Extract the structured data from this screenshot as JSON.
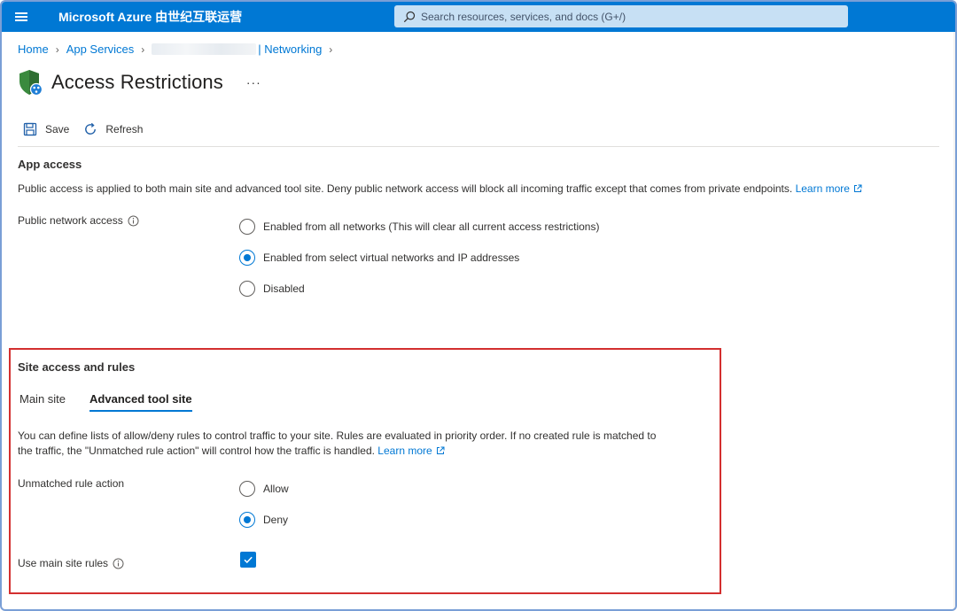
{
  "header": {
    "brand": "Microsoft Azure 由世纪互联运营",
    "search_placeholder": "Search resources, services, and docs (G+/)"
  },
  "breadcrumb": {
    "home": "Home",
    "app_services": "App Services",
    "networking": "| Networking"
  },
  "page": {
    "title": "Access Restrictions",
    "more": "···"
  },
  "toolbar": {
    "save": "Save",
    "refresh": "Refresh"
  },
  "app_access": {
    "heading": "App access",
    "description": "Public access is applied to both main site and advanced tool site. Deny public network access will block all incoming traffic except that comes from private endpoints.",
    "learn_more": "Learn more",
    "public_network_label": "Public network access",
    "options": [
      {
        "label": "Enabled from all networks (This will clear all current access restrictions)",
        "checked": false
      },
      {
        "label": "Enabled from select virtual networks and IP addresses",
        "checked": true
      },
      {
        "label": "Disabled",
        "checked": false
      }
    ]
  },
  "site_access": {
    "heading": "Site access and rules",
    "tabs": [
      {
        "label": "Main site",
        "active": false
      },
      {
        "label": "Advanced tool site",
        "active": true
      }
    ],
    "description_line1": "You can define lists of allow/deny rules to control traffic to your site. Rules are evaluated in priority order. If no created rule is matched to",
    "description_line2": "the traffic, the \"Unmatched rule action\" will control how the traffic is handled.",
    "learn_more": "Learn more",
    "unmatched_label": "Unmatched rule action",
    "unmatched_options": [
      {
        "label": "Allow",
        "checked": false
      },
      {
        "label": "Deny",
        "checked": true
      }
    ],
    "use_main_site_rules_label": "Use main site rules",
    "use_main_site_rules_checked": true
  },
  "colors": {
    "accent": "#0078d4",
    "highlight_border": "#d32f2f"
  }
}
